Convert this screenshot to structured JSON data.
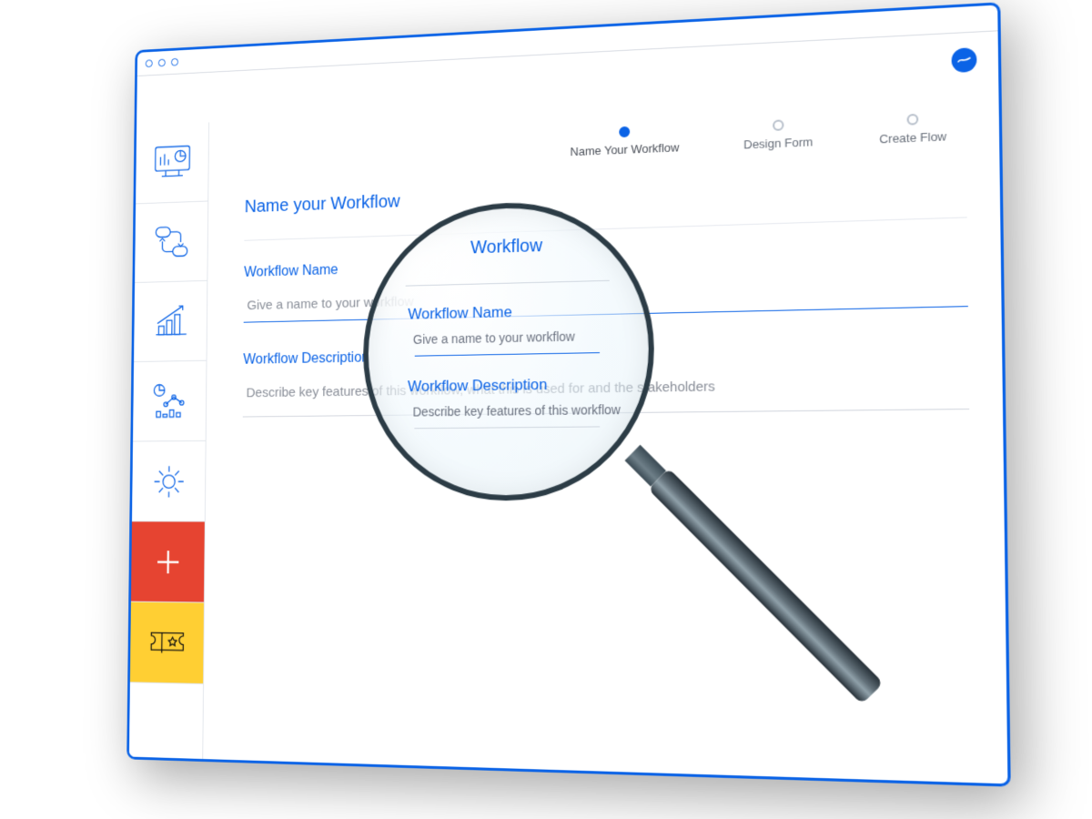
{
  "colors": {
    "accent": "#0b63e6",
    "add_bg": "#e64431",
    "ticket_bg": "#ffcf33"
  },
  "stepper": {
    "steps": [
      {
        "label": "Name Your Workflow",
        "active": true
      },
      {
        "label": "Design Form",
        "active": false
      },
      {
        "label": "Create Flow",
        "active": false
      }
    ]
  },
  "page": {
    "title": "Name your Workflow"
  },
  "fields": {
    "name": {
      "label": "Workflow Name",
      "placeholder": "Give a name to your workflow"
    },
    "description": {
      "label": "Workflow Description",
      "placeholder": "Describe key features of this workflow, what this is used for and the stakeholders"
    }
  },
  "lens": {
    "title_fragment": "Workflow",
    "name_label": "Workflow Name",
    "name_placeholder": "Give a name to your workflow",
    "desc_label": "Workflow Description",
    "desc_placeholder": "Describe key features of this workflow"
  },
  "sidebar": {
    "items": [
      {
        "name": "dashboard"
      },
      {
        "name": "workflows"
      },
      {
        "name": "reports"
      },
      {
        "name": "analytics"
      },
      {
        "name": "settings"
      },
      {
        "name": "add"
      },
      {
        "name": "ticket"
      }
    ]
  }
}
